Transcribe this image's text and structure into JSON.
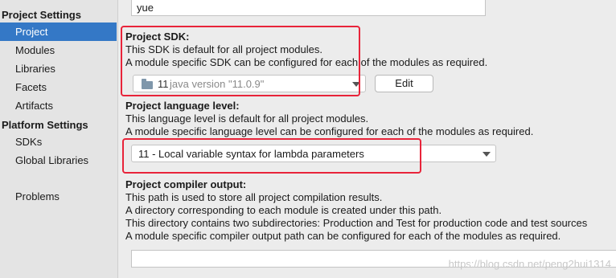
{
  "sidebar": {
    "project_settings_header": "Project Settings",
    "project_settings_items": [
      "Project",
      "Modules",
      "Libraries",
      "Facets",
      "Artifacts"
    ],
    "platform_settings_header": "Platform Settings",
    "platform_settings_items": [
      "SDKs",
      "Global Libraries"
    ],
    "problems": "Problems",
    "selected": "Project"
  },
  "project_name": {
    "value": "yue"
  },
  "sdk": {
    "label": "Project SDK:",
    "desc1": "This SDK is default for all project modules.",
    "desc2": "A module specific SDK can be configured for each of the modules as required.",
    "selected_version": "11",
    "selected_detail": "java version \"11.0.9\"",
    "edit_button": "Edit"
  },
  "language_level": {
    "label": "Project language level:",
    "desc1": "This language level is default for all project modules.",
    "desc2": "A module specific language level can be configured for each of the modules as required.",
    "selected": "11 - Local variable syntax for lambda parameters"
  },
  "compiler_output": {
    "label": "Project compiler output:",
    "desc1": "This path is used to store all project compilation results.",
    "desc2": "A directory corresponding to each module is created under this path.",
    "desc3": "This directory contains two subdirectories: Production and Test for production code and test sources",
    "desc4": "A module specific compiler output path can be configured for each of the modules as required.",
    "value": ""
  },
  "watermark": "https://blog.csdn.net/peng2hui1314",
  "colors": {
    "selection": "#3478c6",
    "highlight_box": "#e8243a"
  }
}
